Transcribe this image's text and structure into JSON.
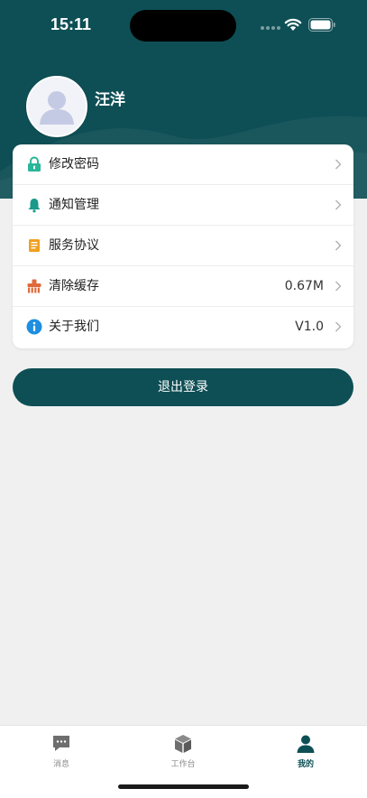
{
  "status_bar": {
    "time": "15:11"
  },
  "theme": {
    "primary": "#0d4f55",
    "background": "#f0f0f0",
    "card": "#ffffff"
  },
  "profile": {
    "name": "汪洋",
    "avatar_icon": "default-user-avatar"
  },
  "menu": {
    "items": [
      {
        "label": "修改密码",
        "value": "",
        "icon": "lock-icon",
        "icon_color": "#2bb59a"
      },
      {
        "label": "通知管理",
        "value": "",
        "icon": "bell-icon",
        "icon_color": "#1a9a8a"
      },
      {
        "label": "服务协议",
        "value": "",
        "icon": "document-icon",
        "icon_color": "#f0a020"
      },
      {
        "label": "清除缓存",
        "value": "0.67M",
        "icon": "broom-icon",
        "icon_color": "#e06a3c"
      },
      {
        "label": "关于我们",
        "value": "V1.0",
        "icon": "info-icon",
        "icon_color": "#1e8ee0"
      }
    ]
  },
  "logout": {
    "label": "退出登录"
  },
  "tab_bar": {
    "tabs": [
      {
        "label": "消息",
        "icon": "message-icon",
        "active": false
      },
      {
        "label": "工作台",
        "icon": "box-icon",
        "active": false
      },
      {
        "label": "我的",
        "icon": "person-icon",
        "active": true
      }
    ]
  }
}
